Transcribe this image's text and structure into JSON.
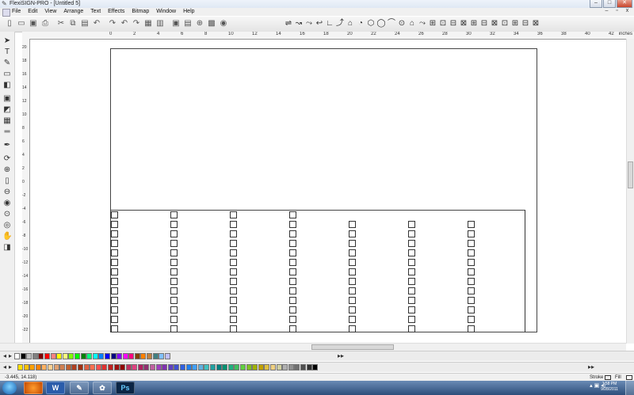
{
  "window": {
    "title": "FlexiSIGN-PRO - [Untitled 5]",
    "minimize": "–",
    "maximize": "□",
    "close": "✕"
  },
  "menubar": {
    "items": [
      "File",
      "Edit",
      "View",
      "Arrange",
      "Text",
      "Effects",
      "Bitmap",
      "Window",
      "Help"
    ],
    "mdi_min": "–",
    "mdi_restore": "▫",
    "mdi_close": "x"
  },
  "ruler": {
    "unit": "inches",
    "top_labels": [
      "0",
      "2",
      "4",
      "6",
      "8",
      "10",
      "12",
      "14",
      "16",
      "18",
      "20",
      "22",
      "24",
      "26",
      "28",
      "30",
      "32",
      "34",
      "36",
      "38",
      "40",
      "42"
    ],
    "left_labels": [
      "20",
      "18",
      "16",
      "14",
      "12",
      "10",
      "8",
      "6",
      "4",
      "2",
      "0",
      "-2",
      "-4",
      "-6",
      "-8",
      "-10",
      "-12",
      "-14",
      "-16",
      "-18",
      "-20",
      "-22"
    ]
  },
  "status": {
    "coords": "-3.445,   14.118)",
    "stroke_label": "Stroke",
    "fill_label": "Fill"
  },
  "taskbar": {
    "word_label": "W",
    "ps_label": "Ps",
    "time": "1:58 PM",
    "date": "9/28/2011"
  },
  "icons": [
    "new-icon",
    "open-icon",
    "save-icon",
    "print-icon",
    "cut-icon",
    "copy-icon",
    "paste-icon",
    "undo-icon",
    "redo-icon",
    "zoom-icon",
    "color-icon"
  ],
  "colors": {
    "palette1": [
      "#ffffff",
      "#000000",
      "#c0c0c0",
      "#808080",
      "#800000",
      "#ff0000",
      "#ff8080",
      "#ffff00",
      "#ffff80",
      "#80ff00",
      "#00ff00",
      "#008000",
      "#00ff80",
      "#00ffff",
      "#0080ff",
      "#0000ff",
      "#000080",
      "#8000ff",
      "#ff00ff",
      "#ff0080",
      "#804000",
      "#ff8000",
      "#c08040",
      "#408080",
      "#80c0ff",
      "#c0c0ff"
    ],
    "palette2": [
      "#ffe000",
      "#ffc000",
      "#ffa000",
      "#ff8000",
      "#ffb060",
      "#ffd090",
      "#e0a070",
      "#d08050",
      "#c06030",
      "#b04020",
      "#a03010",
      "#e06040",
      "#ff7050",
      "#ff5050",
      "#e03030",
      "#c02020",
      "#a01010",
      "#900000",
      "#c03060",
      "#e04080",
      "#b02060",
      "#903070",
      "#c060a0",
      "#a040c0",
      "#8030b0",
      "#6040c0",
      "#4050d0",
      "#3060e0",
      "#2080f0",
      "#40a0ff",
      "#60b0e0",
      "#40c0c0",
      "#20a0a0",
      "#008080",
      "#009070",
      "#20b080",
      "#40c060",
      "#60d040",
      "#80c020",
      "#a0b000",
      "#c0a000",
      "#e0c040",
      "#f0d080",
      "#d0d0a0",
      "#b0b0b0",
      "#909090",
      "#707070",
      "#505050",
      "#303030",
      "#000000"
    ]
  }
}
